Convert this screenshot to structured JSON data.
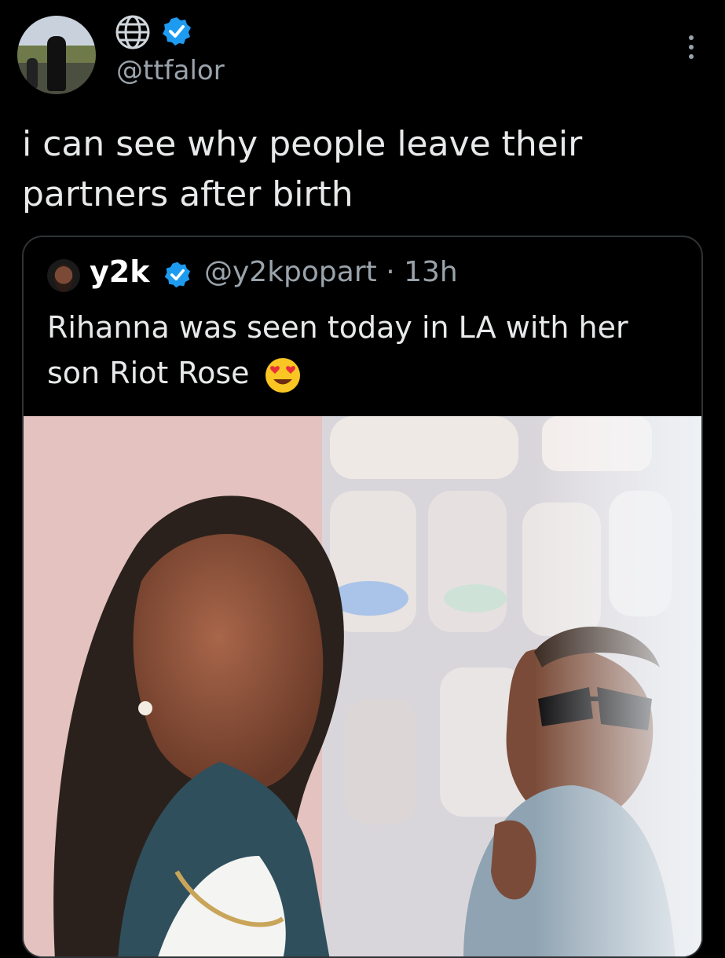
{
  "author": {
    "handle": "@ttfalor",
    "icons": [
      "globe-icon",
      "verified-icon"
    ]
  },
  "tweet": {
    "text": "i can see why people leave their partners after birth"
  },
  "quoted_tweet": {
    "name": "y2k",
    "handle_time": "@y2kpopart · 13h",
    "text": "Rihanna was seen today in LA with her son Riot Rose",
    "emoji": "heart-eyes-emoji"
  },
  "colors": {
    "background": "#000000",
    "text": "#e7e9ea",
    "muted": "#9aa3ab",
    "verified": "#1d9bf0",
    "border": "#2f3336"
  }
}
